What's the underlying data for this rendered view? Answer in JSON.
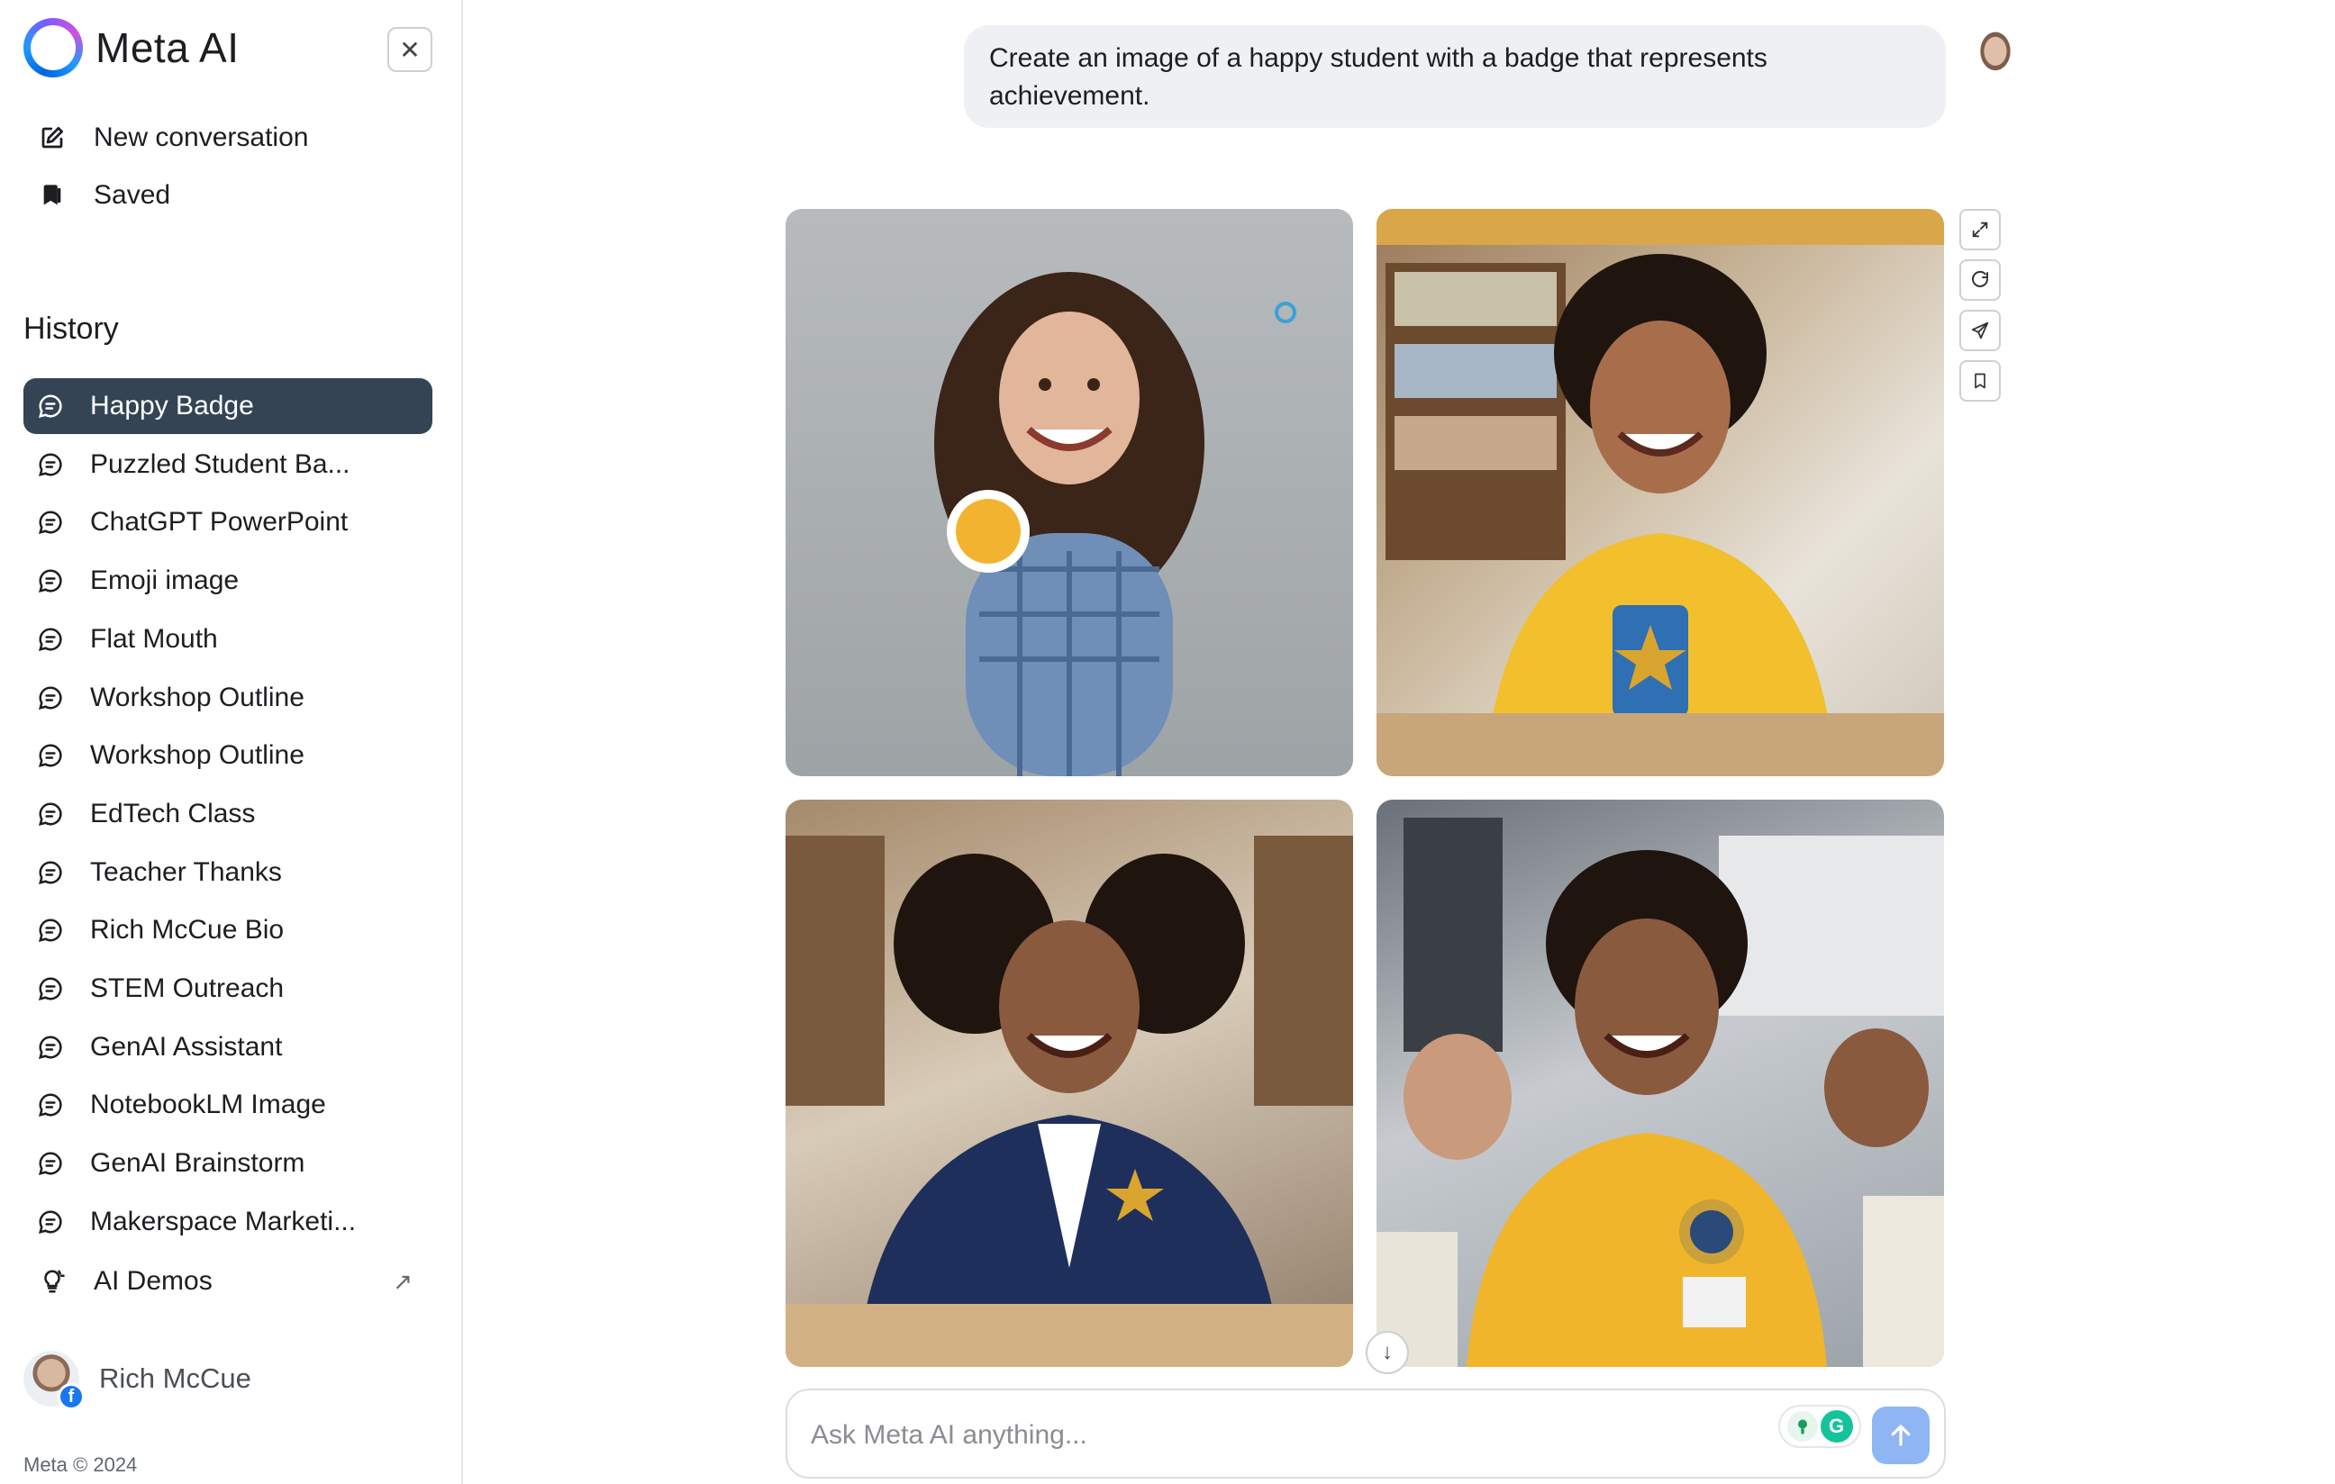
{
  "brand": {
    "name": "Meta AI"
  },
  "sidebar": {
    "close_icon": "close-icon",
    "nav": [
      {
        "label": "New conversation",
        "icon": "compose-icon"
      },
      {
        "label": "Saved",
        "icon": "bookmark-icon"
      }
    ],
    "history_title": "History",
    "history": [
      {
        "label": "Happy Badge",
        "active": true
      },
      {
        "label": "Puzzled Student Ba..."
      },
      {
        "label": "ChatGPT PowerPoint"
      },
      {
        "label": "Emoji image"
      },
      {
        "label": "Flat Mouth"
      },
      {
        "label": "Workshop Outline"
      },
      {
        "label": "Workshop Outline"
      },
      {
        "label": "EdTech Class"
      },
      {
        "label": "Teacher Thanks"
      },
      {
        "label": "Rich McCue Bio"
      },
      {
        "label": "STEM Outreach"
      },
      {
        "label": "GenAI Assistant"
      },
      {
        "label": "NotebookLM Image"
      },
      {
        "label": "GenAI Brainstorm"
      },
      {
        "label": "Makerspace Marketi..."
      }
    ],
    "ai_demos": {
      "label": "AI Demos",
      "icon": "lightbulb-icon",
      "arrow": "↗"
    },
    "user": {
      "name": "Rich McCue",
      "badge": "f"
    },
    "copyright": "Meta © 2024"
  },
  "chat": {
    "prompt": "Create an image of a happy student with a badge that represents achievement.",
    "images": [
      {
        "alt": "Smiling student holding a badge"
      },
      {
        "alt": "Smiling student wearing star badge in library"
      },
      {
        "alt": "Smiling student in blazer with star pin"
      },
      {
        "alt": "Smiling student with medal badge in classroom"
      }
    ],
    "actions": [
      "expand-icon",
      "regenerate-icon",
      "share-icon",
      "save-icon"
    ]
  },
  "composer": {
    "placeholder": "Ask Meta AI anything...",
    "plugin_g": "G"
  },
  "colors": {
    "active_item": "#344454",
    "send_button": "#8fb6f3",
    "bubble": "#eef0f3"
  }
}
